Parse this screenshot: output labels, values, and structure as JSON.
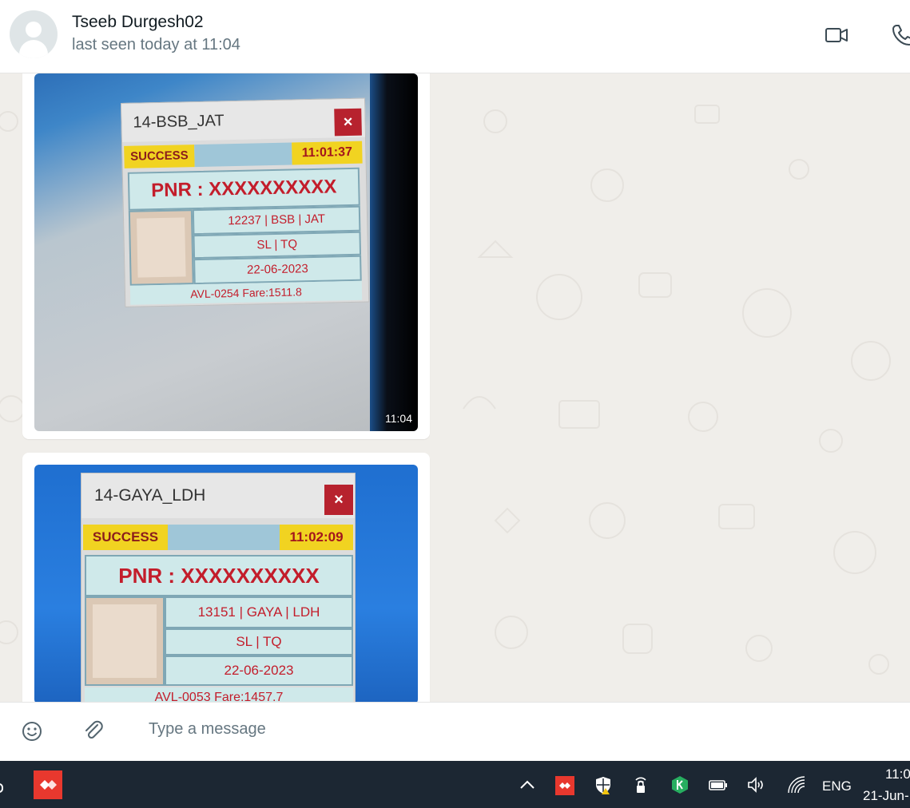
{
  "header": {
    "contact_name": "Tseeb Durgesh02",
    "status": "last seen today at 11:04",
    "icons": [
      "video-call-icon",
      "voice-call-icon"
    ]
  },
  "messages": [
    {
      "type": "image",
      "timestamp": "11:04",
      "ticket": {
        "window_title": "14-BSB_JAT",
        "status": "SUCCESS",
        "time": "11:01:37",
        "pnr": "PNR : XXXXXXXXXX",
        "route": "12237 | BSB | JAT",
        "class_quota": "SL | TQ",
        "date": "22-06-2023",
        "footer": "AVL-0254 Fare:1511.8",
        "close_symbol": "×"
      }
    },
    {
      "type": "image",
      "ticket": {
        "window_title": "14-GAYA_LDH",
        "status": "SUCCESS",
        "time": "11:02:09",
        "pnr": "PNR : XXXXXXXXXX",
        "route": "13151 | GAYA | LDH",
        "class_quota": "SL | TQ",
        "date": "22-06-2023",
        "footer": "AVL-0053 Fare:1457.7",
        "close_symbol": "×"
      }
    }
  ],
  "compose": {
    "placeholder": "Type a message",
    "icons": [
      "emoji-icon",
      "attach-icon"
    ]
  },
  "taskbar": {
    "language": "ENG",
    "clock_time": "11:0",
    "clock_date": "21-Jun-",
    "accent_app_color": "#e8382e",
    "icons": [
      "show-hidden-icon",
      "anydesk-tray-icon",
      "security-shield-icon",
      "vpn-lock-icon",
      "kaspersky-icon",
      "battery-icon",
      "volume-icon",
      "wifi-icon"
    ]
  },
  "colors": {
    "header_bg": "#ffffff",
    "chat_bg": "#f0eeea",
    "taskbar_bg": "#1c2733",
    "ticket_red": "#c31d2b",
    "ticket_yellow": "#f1d321"
  }
}
